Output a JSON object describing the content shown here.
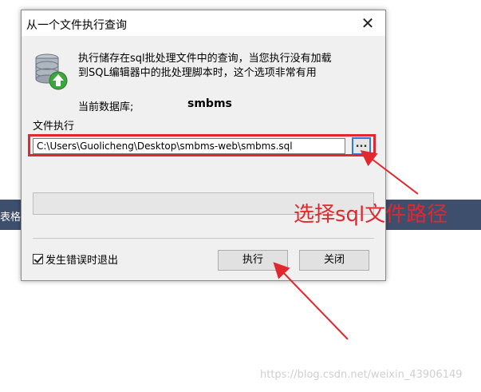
{
  "background": {
    "label": "表格"
  },
  "dialog": {
    "title": "从一个文件执行查询",
    "description_line1": "执行储存在sql批处理文件中的查询，当您执行没有加载",
    "description_line2": "到SQL编辑器中的批处理脚本时，这个选项非常有用",
    "current_db_label": "当前数据库;",
    "current_db_value": "smbms",
    "file_label": "文件执行",
    "file_path": "C:\\Users\\Guolicheng\\Desktop\\smbms-web\\smbms.sql",
    "browse_label": "...",
    "checkbox_label": "发生错误时退出",
    "checkbox_checked": true,
    "execute_label": "执行",
    "close_label": "关闭"
  },
  "annotation": {
    "text": "选择sql文件路径"
  },
  "watermark": "https://blog.csdn.net/weixin_43906149",
  "colors": {
    "accent": "#e0282e",
    "browse_border": "#2f7bd8",
    "bg_strip": "#3e4f6e"
  },
  "icons": {
    "database": "database-icon",
    "close": "close-icon"
  }
}
